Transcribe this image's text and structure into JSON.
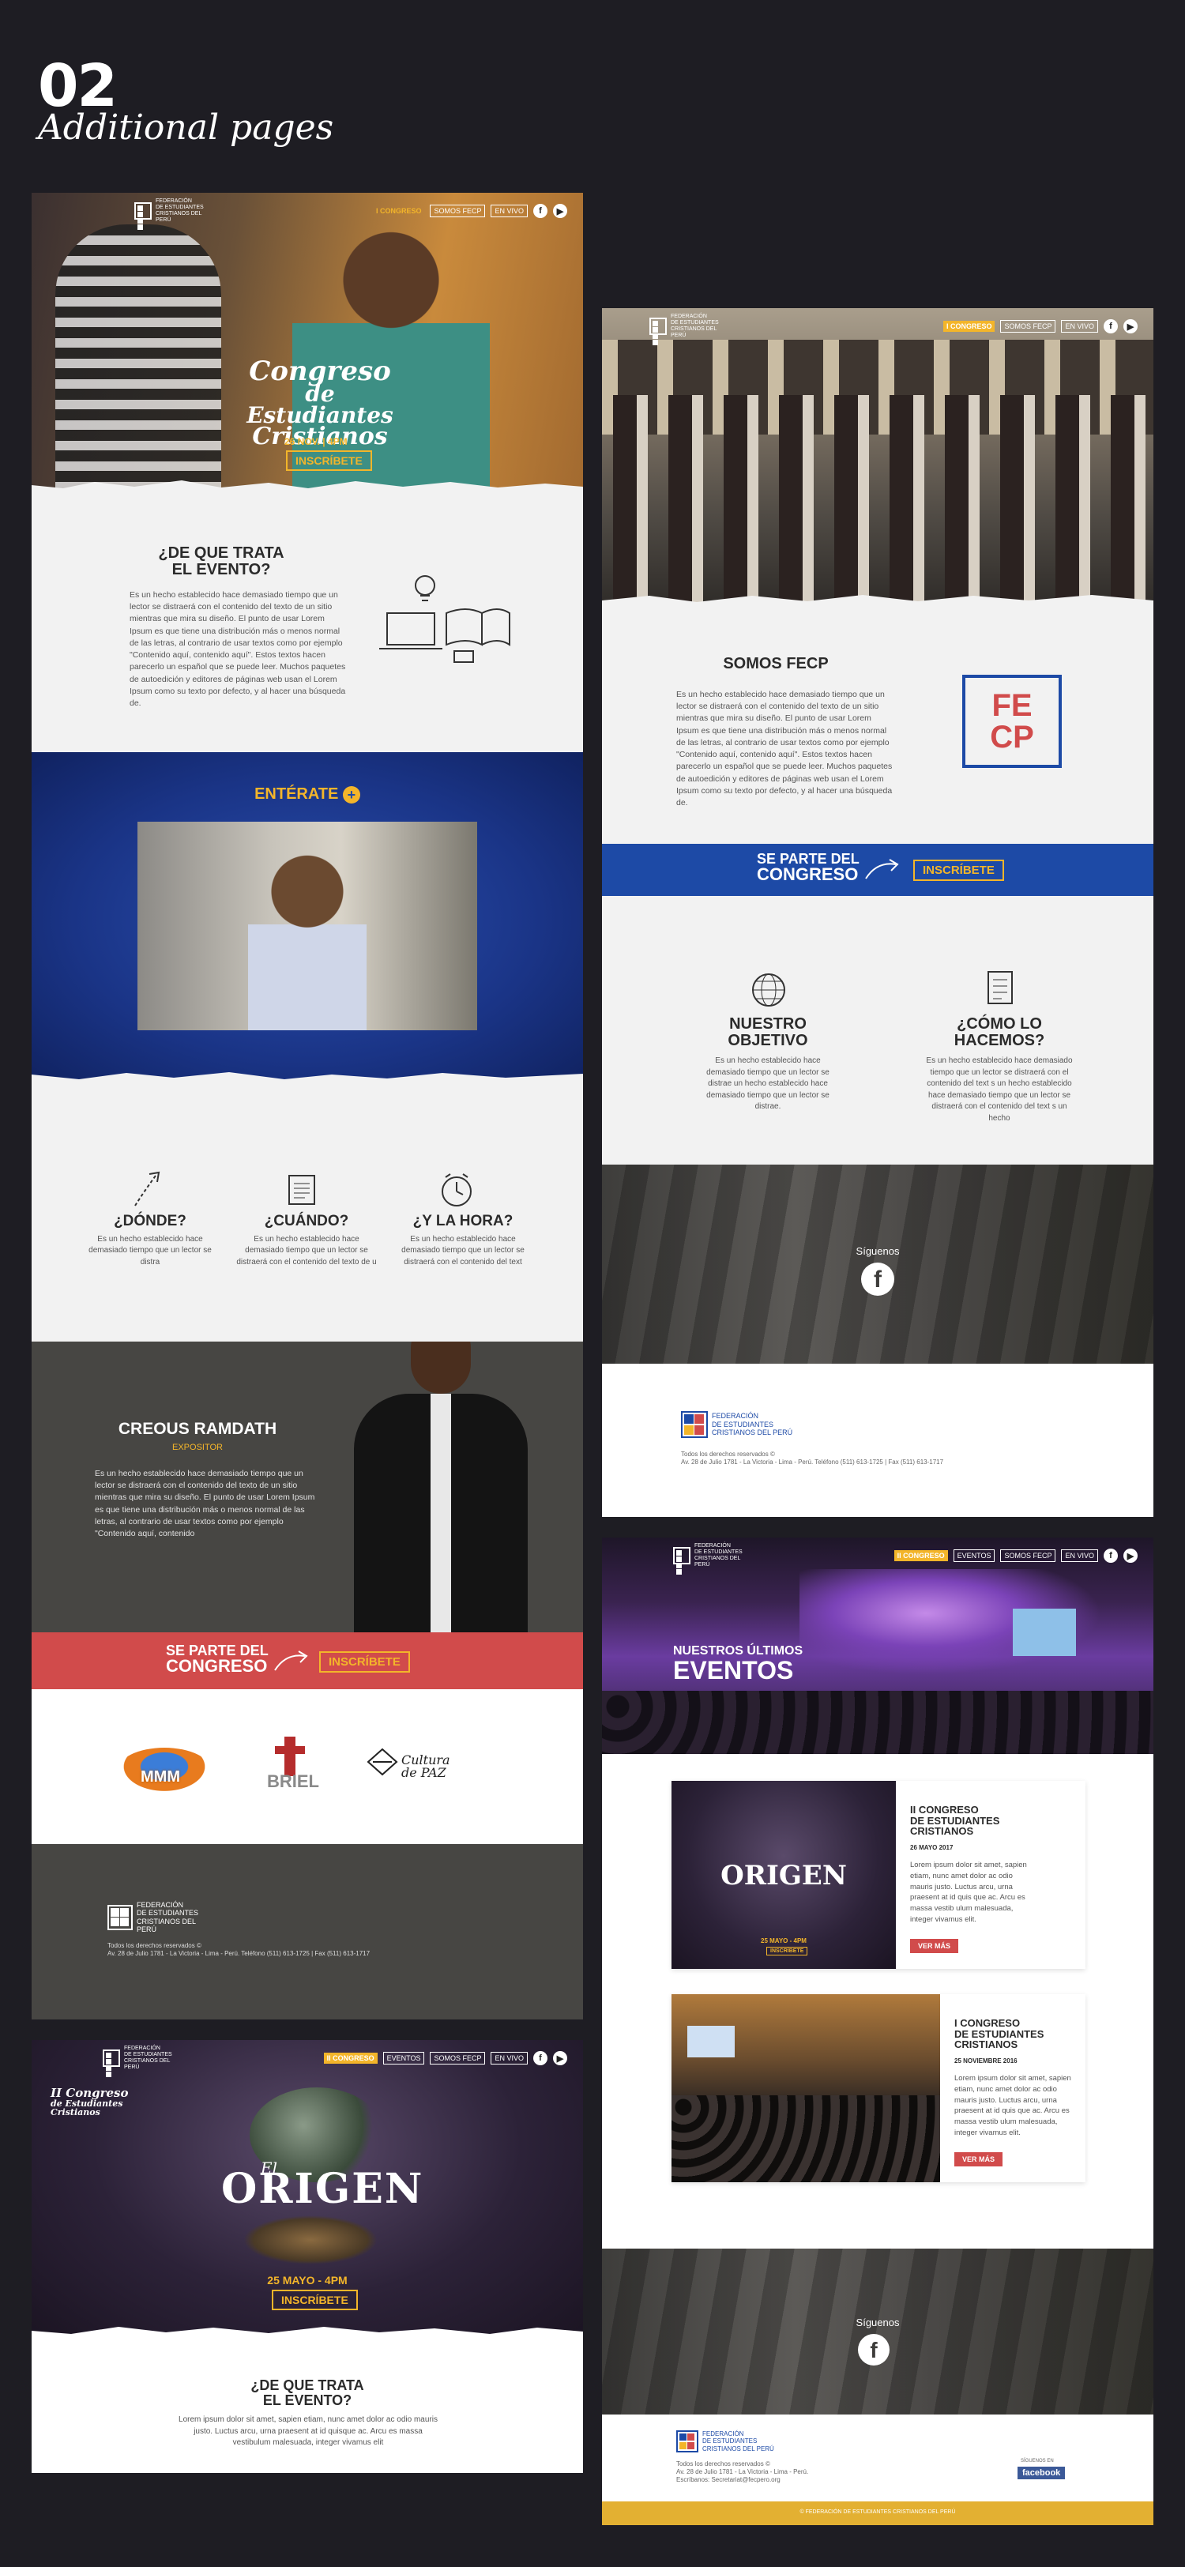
{
  "header": {
    "number": "02",
    "subtitle": "Additional pages"
  },
  "colors": {
    "background": "#1e1d23",
    "accent_yellow": "#f3b52a",
    "blue": "#1d4aa6",
    "red": "#d14b4b",
    "dark_gray": "#474643",
    "purple": "#2c2238"
  },
  "logo": {
    "line1": "FEDERACIÓN",
    "line2": "DE ESTUDIANTES",
    "line3": "CRISTIANOS DEL PERÚ",
    "letters": "FE CP"
  },
  "nav": {
    "congreso": "I CONGRESO",
    "congreso2": "II CONGRESO",
    "somos": "SOMOS FECP",
    "envivo": "EN VIVO",
    "eventos": "EVENTOS"
  },
  "panel1": {
    "hero": {
      "title1": "Congreso",
      "title2": "de Estudiantes",
      "title3": "Cristianos",
      "date": "26 NOV. | 4PM",
      "button": "INSCRÍBETE"
    },
    "about": {
      "title": "¿DE QUE TRATA\nEL EVENTO?",
      "text": "Es un hecho establecido hace demasiado tiempo que un lector se distraerá con el contenido del texto de un sitio mientras que mira su diseño. El punto de usar Lorem Ipsum es que tiene una distribución más o menos normal de las letras, al contrario de usar textos como por ejemplo \"Contenido aquí, contenido aquí\". Estos textos hacen parecerlo un español que se puede leer. Muchos paquetes de autoedición y editores de páginas web usan el Lorem Ipsum como su texto por defecto, y al hacer una búsqueda de."
    },
    "video": {
      "title": "ENTÉRATE"
    },
    "info": [
      {
        "title": "¿DÓNDE?",
        "text": "Es un hecho establecido hace demasiado tiempo que un lector se distra"
      },
      {
        "title": "¿CUÁNDO?",
        "text": "Es un hecho establecido hace demasiado tiempo que un lector se distraerá con el contenido del texto de u"
      },
      {
        "title": "¿Y LA HORA?",
        "text": "Es un hecho establecido hace demasiado tiempo que un lector se distraerá con el contenido del text"
      }
    ],
    "speaker": {
      "name": "CREOUS RAMDATH",
      "role": "EXPOSITOR",
      "text": "Es un hecho establecido hace demasiado tiempo que un lector se distraerá con el contenido del texto de un sitio mientras que mira su diseño. El punto de usar Lorem Ipsum es que tiene una distribución más o menos normal de las letras, al contrario de usar textos como por ejemplo \"Contenido aquí, contenido"
    },
    "cta": {
      "line1": "SE PARTE DEL",
      "line2": "CONGRESO",
      "button": "INSCRÍBETE"
    },
    "sponsors": [
      "MMM",
      "BRIEL",
      "Cultura de PAZ"
    ],
    "footer": {
      "rights": "Todos los derechos reservados ©",
      "address": "Av. 28 de Julio 1781 - La Victoria - Lima - Perú. Teléfono (511) 613-1725 | Fax (511) 613-1717"
    }
  },
  "panel2": {
    "about": {
      "title": "SOMOS FECP",
      "text": "Es un hecho establecido hace demasiado tiempo que un lector se distraerá con el contenido del texto de un sitio mientras que mira su diseño. El punto de usar Lorem Ipsum es que tiene una distribución más o menos normal de las letras, al contrario de usar textos como por ejemplo \"Contenido aquí, contenido aquí\". Estos textos hacen parecerlo un español que se puede leer. Muchos paquetes de autoedición y editores de páginas web usan el Lorem Ipsum como su texto por defecto, y al hacer una búsqueda de."
    },
    "cta": {
      "line1": "SE PARTE DEL",
      "line2": "CONGRESO",
      "button": "INSCRÍBETE"
    },
    "goal": {
      "title": "NUESTRO\nOBJETIVO",
      "text": "Es un hecho establecido hace demasiado tiempo que un lector se distrae un hecho establecido hace demasiado tiempo que un lector se distrae."
    },
    "how": {
      "title": "¿CÓMO LO\nHACEMOS?",
      "text": "Es un hecho establecido hace demasiado tiempo que un lector se distraerá con el contenido del text s un hecho establecido hace demasiado tiempo que un lector se distraerá con el contenido del text s un hecho"
    },
    "social": {
      "label": "Síguenos"
    },
    "footer": {
      "rights": "Todos los derechos reservados ©",
      "address": "Av. 28 de Julio 1781 - La Victoria - Lima - Perú. Teléfono (511) 613-1725 | Fax (511) 613-1717"
    }
  },
  "panel3": {
    "hero": {
      "line1": "NUESTROS ÚLTIMOS",
      "line2": "EVENTOS"
    },
    "events": [
      {
        "poster": "ORIGEN",
        "poster_date": "25 MAYO - 4PM",
        "poster_button": "INSCRÍBETE",
        "title": "II CONGRESO\nDE ESTUDIANTES\nCRISTIANOS",
        "date": "26 MAYO 2017",
        "text": "Lorem ipsum dolor sit amet, sapien etiam, nunc amet dolor ac odio mauris justo. Luctus arcu, urna praesent at id quis que ac. Arcu es massa vestib ulum malesuada, integer vivamus elit.",
        "button": "VER MÁS"
      },
      {
        "title": "I CONGRESO\nDE ESTUDIANTES\nCRISTIANOS",
        "date": "25 NOVIEMBRE 2016",
        "text": "Lorem ipsum dolor sit amet, sapien etiam, nunc amet dolor ac odio mauris justo. Luctus arcu, urna praesent at id quis que ac. Arcu es massa vestib ulum malesuada, integer vivamus elit.",
        "button": "VER MÁS"
      }
    ],
    "social": {
      "label": "Síguenos"
    },
    "footer": {
      "rights": "Todos los derechos reservados ©",
      "address": "Av. 28 de Julio 1781 - La Victoria - Lima - Perú.",
      "email": "Escríbanos: Secretariat@fecpero.org",
      "follow": "SÍGUENOS EN",
      "facebook": "facebook",
      "bottom": "© FEDERACIÓN DE ESTUDIANTES CRISTIANOS DEL PERÚ"
    }
  },
  "panel4": {
    "hero": {
      "brand1": "II Congreso",
      "brand2": "de Estudiantes Cristianos",
      "title1": "El",
      "title2": "ORIGEN",
      "date": "25 MAYO - 4PM",
      "button": "INSCRÍBETE"
    },
    "about": {
      "title": "¿DE QUE TRATA\nEL EVENTO?",
      "text": "Lorem ipsum dolor sit amet, sapien etiam, nunc amet dolor ac odio mauris justo. Luctus arcu, urna praesent at id quisque ac. Arcu es massa vestibulum malesuada, integer vivamus elit"
    }
  }
}
